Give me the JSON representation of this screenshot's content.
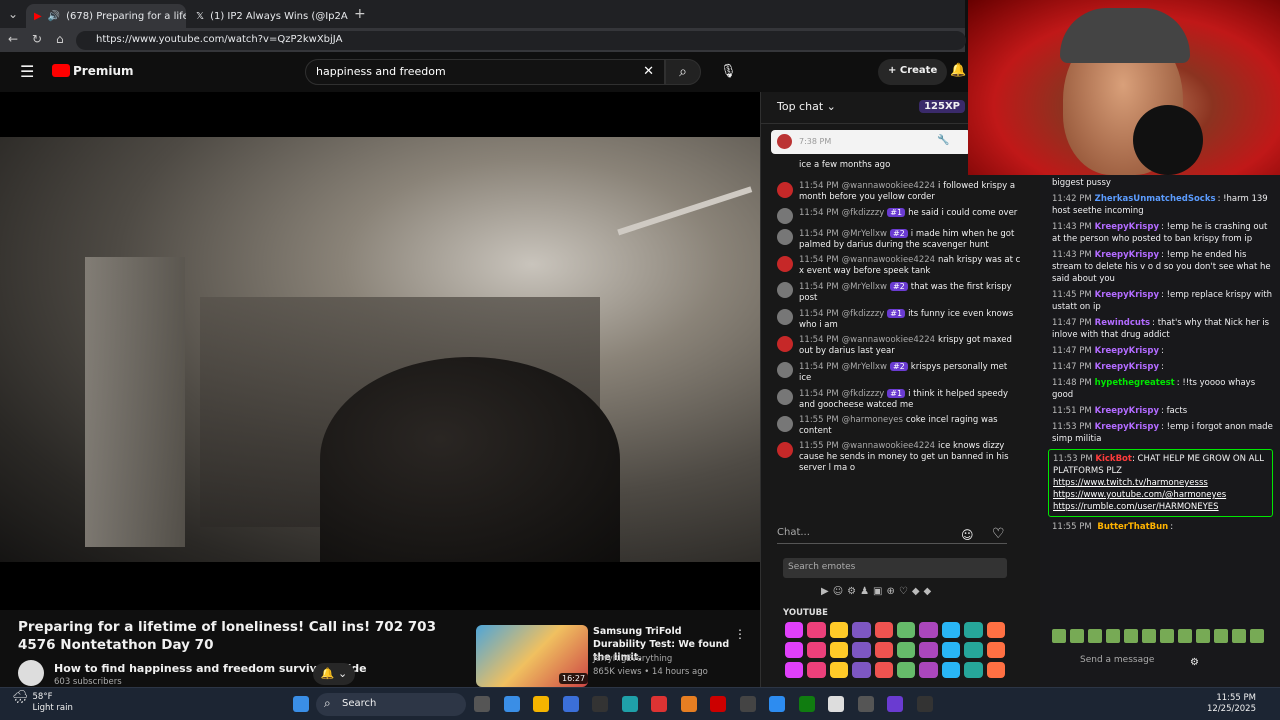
{
  "browser": {
    "tabs": [
      {
        "label": "(678) Preparing for a lifetime"
      },
      {
        "label": "(1) IP2 Always Wins (@Ip2AlwaysW"
      }
    ],
    "url": "https://www.youtube.com/watch?v=QzP2kwXbjJA"
  },
  "youtube": {
    "logo": "Premium",
    "search_value": "happiness and freedom",
    "create_label": "Create",
    "video_title": "Preparing for a lifetime of loneliness! Call ins! 702 703 4576 Nontetathon Day 70",
    "channel_name": "How to find happiness and freedom survival guide",
    "subscribers": "603 subscribers",
    "recommended": {
      "title": "Samsung TriFold Durability Test: We found the limit.",
      "channel": "JerryRigEverything",
      "meta": "865K views • 14 hours ago",
      "duration": "16:27"
    }
  },
  "ytchat": {
    "header": "Top chat",
    "xp": "125XP",
    "pinned_time": "7:38 PM",
    "messages": [
      {
        "time": "",
        "author": "",
        "badge": "",
        "text": "ice a few months ago"
      },
      {
        "time": "11:54 PM",
        "author": "@wannawookiee4224",
        "badge": "",
        "text": "i followed krispy a month before you yellow corder"
      },
      {
        "time": "11:54 PM",
        "author": "@fkdizzzy",
        "badge": "#1",
        "text": "he said i could come over"
      },
      {
        "time": "11:54 PM",
        "author": "@MrYellxw",
        "badge": "#2",
        "text": "i made him when he got palmed by darius during the scavenger hunt"
      },
      {
        "time": "11:54 PM",
        "author": "@wannawookiee4224",
        "badge": "",
        "text": "nah krispy was at c x event way before speek tank"
      },
      {
        "time": "11:54 PM",
        "author": "@MrYellxw",
        "badge": "#2",
        "text": "that was the first krispy post"
      },
      {
        "time": "11:54 PM",
        "author": "@fkdizzzy",
        "badge": "#1",
        "text": "its funny ice even knows who i am"
      },
      {
        "time": "11:54 PM",
        "author": "@wannawookiee4224",
        "badge": "",
        "text": "krispy got maxed out by darius last year"
      },
      {
        "time": "11:54 PM",
        "author": "@MrYellxw",
        "badge": "#2",
        "text": "krispys personally met ice"
      },
      {
        "time": "11:54 PM",
        "author": "@fkdizzzy",
        "badge": "#1",
        "text": "i think it helped speedy and goocheese watced me"
      },
      {
        "time": "11:55 PM",
        "author": "@harmoneyes",
        "badge": "",
        "text": "coke incel raging was content"
      },
      {
        "time": "11:55 PM",
        "author": "@wannawookiee4224",
        "badge": "",
        "text": "ice knows dizzy cause he sends in money to get un banned in his server l ma o"
      }
    ],
    "input_placeholder": "Chat...",
    "emote_search_placeholder": "Search emotes",
    "emote_section": "YOUTUBE"
  },
  "sidechat": {
    "messages": [
      {
        "time": "",
        "user": "",
        "color": "#efeff1",
        "text": "biggest pussy"
      },
      {
        "time": "11:42 PM",
        "user": "ZherkasUnmatchedSocks",
        "color": "#5b9cff",
        "text": "!harm 139 host seethe incoming"
      },
      {
        "time": "11:43 PM",
        "user": "KreepyKrispy",
        "color": "#b26bff",
        "text": "!emp he is crashing out at the person who posted to ban krispy from ip"
      },
      {
        "time": "11:43 PM",
        "user": "KreepyKrispy",
        "color": "#b26bff",
        "text": "!emp he ended his stream to delete his v o d so you don't see what he said about you"
      },
      {
        "time": "11:45 PM",
        "user": "KreepyKrispy",
        "color": "#b26bff",
        "text": "!emp replace krispy with ustatt on ip"
      },
      {
        "time": "11:47 PM",
        "user": "Rewindcuts",
        "color": "#b26bff",
        "text": "that's why that Nick her is inlove with that drug addict"
      },
      {
        "time": "11:47 PM",
        "user": "KreepyKrispy",
        "color": "#b26bff",
        "text": ""
      },
      {
        "time": "11:47 PM",
        "user": "KreepyKrispy",
        "color": "#b26bff",
        "text": ""
      },
      {
        "time": "11:48 PM",
        "user": "hypethegreatest",
        "color": "#00e701",
        "text": "!!ts yoooo whays good"
      },
      {
        "time": "11:51 PM",
        "user": "KreepyKrispy",
        "color": "#b26bff",
        "text": "facts"
      },
      {
        "time": "11:53 PM",
        "user": "KreepyKrispy",
        "color": "#b26bff",
        "text": "!emp i forgot anon made simp militia"
      }
    ],
    "highlight": {
      "time": "11:53 PM",
      "user": "KickBot",
      "text": "CHAT HELP ME GROW ON ALL PLATFORMS PLZ",
      "links": [
        "https://www.twitch.tv/harmoneyesss",
        "https://www.youtube.com/@harmoneyes",
        "https://rumble.com/user/HARMONEYES"
      ]
    },
    "last": {
      "time": "11:55 PM",
      "user": "ButterThatBun",
      "color": "#ffb300"
    },
    "send_placeholder": "Send a message"
  },
  "taskbar": {
    "temp": "58°F",
    "weather": "Light rain",
    "search": "Search",
    "time": "11:55 PM",
    "date": "12/25/2025"
  }
}
